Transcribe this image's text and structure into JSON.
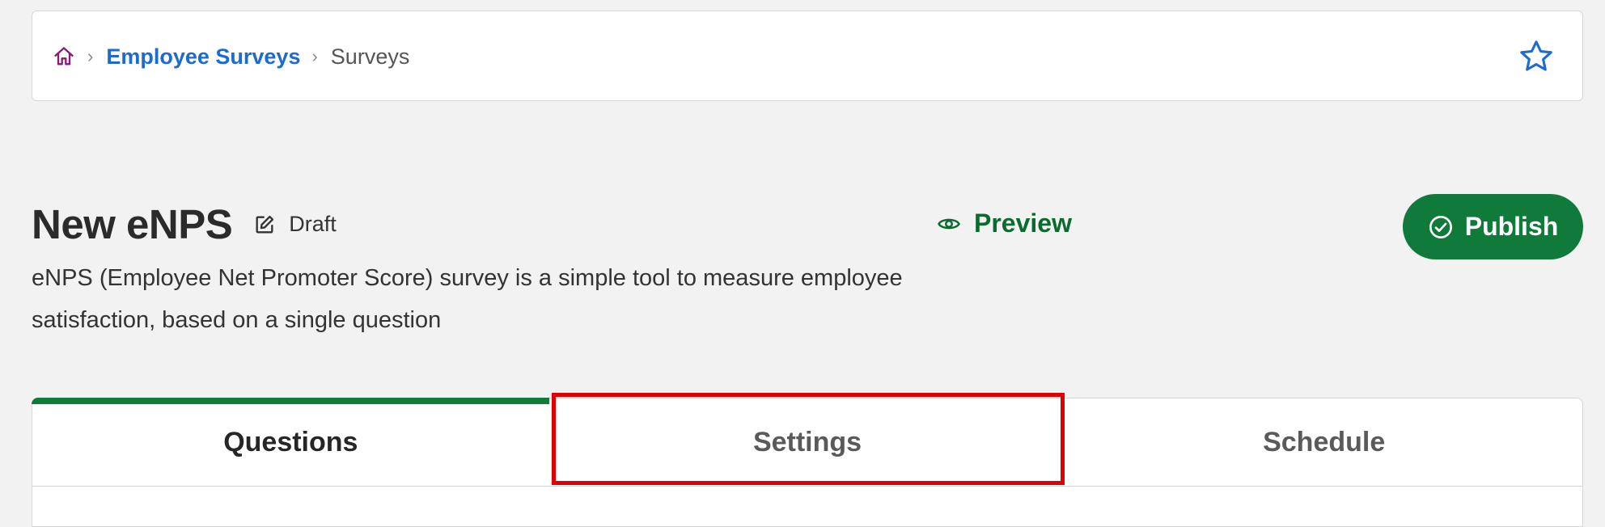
{
  "breadcrumb": {
    "home_icon": "home-icon",
    "items": [
      {
        "label": "Employee Surveys",
        "link": true
      },
      {
        "label": "Surveys",
        "link": false
      }
    ],
    "separator": "›"
  },
  "favorite_icon": "star-outline-icon",
  "survey": {
    "title": "New eNPS",
    "status": "Draft",
    "description": "eNPS (Employee Net Promoter Score) survey is a simple tool to measure employee satisfaction, based on a single question"
  },
  "actions": {
    "preview_label": "Preview",
    "publish_label": "Publish"
  },
  "tabs": [
    {
      "label": "Questions",
      "active": true
    },
    {
      "label": "Settings",
      "active": false,
      "highlighted": true
    },
    {
      "label": "Schedule",
      "active": false
    }
  ],
  "colors": {
    "brand_green": "#0f7a3a",
    "link_blue": "#1d6ad0",
    "highlight_red": "#e00000",
    "home_icon_purple": "#8a1a7a"
  }
}
